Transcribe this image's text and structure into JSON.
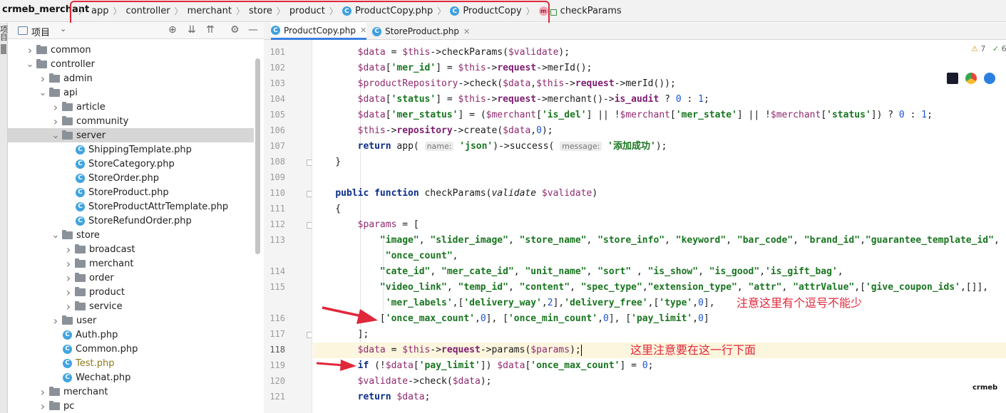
{
  "navbar": {
    "project": "crmeb_merchant",
    "crumbs": [
      {
        "label": "app",
        "icon": ""
      },
      {
        "label": "controller",
        "icon": ""
      },
      {
        "label": "merchant",
        "icon": ""
      },
      {
        "label": "store",
        "icon": ""
      },
      {
        "label": "product",
        "icon": ""
      },
      {
        "label": "ProductCopy.php",
        "icon": "php-class-icon"
      },
      {
        "label": "ProductCopy",
        "icon": "php-class-icon"
      },
      {
        "label": "checkParams",
        "icon": "method-icon"
      }
    ],
    "highlight_color": "#e0283a"
  },
  "toolstrip": {
    "label": "项目"
  },
  "project_panel": {
    "title": "项目",
    "tree": [
      {
        "label": "common",
        "type": "folder",
        "depth": 2,
        "expanded": false
      },
      {
        "label": "controller",
        "type": "folder",
        "depth": 2,
        "expanded": true
      },
      {
        "label": "admin",
        "type": "folder",
        "depth": 3,
        "expanded": false
      },
      {
        "label": "api",
        "type": "folder",
        "depth": 3,
        "expanded": true
      },
      {
        "label": "article",
        "type": "folder",
        "depth": 4,
        "expanded": false
      },
      {
        "label": "community",
        "type": "folder",
        "depth": 4,
        "expanded": false
      },
      {
        "label": "server",
        "type": "folder",
        "depth": 4,
        "expanded": true,
        "selected": true
      },
      {
        "label": "ShippingTemplate.php",
        "type": "file",
        "depth": 5
      },
      {
        "label": "StoreCategory.php",
        "type": "file",
        "depth": 5
      },
      {
        "label": "StoreOrder.php",
        "type": "file",
        "depth": 5
      },
      {
        "label": "StoreProduct.php",
        "type": "file",
        "depth": 5
      },
      {
        "label": "StoreProductAttrTemplate.php",
        "type": "file",
        "depth": 5
      },
      {
        "label": "StoreRefundOrder.php",
        "type": "file",
        "depth": 5
      },
      {
        "label": "store",
        "type": "folder",
        "depth": 4,
        "expanded": true
      },
      {
        "label": "broadcast",
        "type": "folder",
        "depth": 5,
        "expanded": false
      },
      {
        "label": "merchant",
        "type": "folder",
        "depth": 5,
        "expanded": false
      },
      {
        "label": "order",
        "type": "folder",
        "depth": 5,
        "expanded": false
      },
      {
        "label": "product",
        "type": "folder",
        "depth": 5,
        "expanded": false
      },
      {
        "label": "service",
        "type": "folder",
        "depth": 5,
        "expanded": false
      },
      {
        "label": "user",
        "type": "folder",
        "depth": 4,
        "expanded": false
      },
      {
        "label": "Auth.php",
        "type": "file",
        "depth": 4
      },
      {
        "label": "Common.php",
        "type": "file",
        "depth": 4
      },
      {
        "label": "Test.php",
        "type": "file",
        "depth": 4,
        "warning": true
      },
      {
        "label": "Wechat.php",
        "type": "file",
        "depth": 4
      },
      {
        "label": "merchant",
        "type": "folder",
        "depth": 3,
        "expanded": false
      },
      {
        "label": "pc",
        "type": "folder",
        "depth": 3,
        "expanded": false
      }
    ]
  },
  "editor": {
    "tabs": [
      {
        "label": "ProductCopy.php",
        "active": true
      },
      {
        "label": "StoreProduct.php",
        "active": false
      }
    ],
    "inspection": {
      "warnings": "7",
      "ok": "6"
    },
    "watermark": "crmeb",
    "lines": [
      {
        "no": "101",
        "code": [
          [
            "",
            "        "
          ],
          [
            "v",
            "$data"
          ],
          [
            "",
            " = "
          ],
          [
            "v",
            "$this"
          ],
          [
            "",
            "->checkParams("
          ],
          [
            "v",
            "$validate"
          ],
          [
            "",
            ");"
          ]
        ]
      },
      {
        "no": "102",
        "code": [
          [
            "",
            "        "
          ],
          [
            "v",
            "$data"
          ],
          [
            "",
            "["
          ],
          [
            "s",
            "'mer_id'"
          ],
          [
            "",
            "] = "
          ],
          [
            "v",
            "$this"
          ],
          [
            "",
            "->"
          ],
          [
            "pp",
            "request"
          ],
          [
            "",
            "->merId();"
          ]
        ]
      },
      {
        "no": "103",
        "code": [
          [
            "",
            "        "
          ],
          [
            "v",
            "$productRepository"
          ],
          [
            "",
            "->check("
          ],
          [
            "v",
            "$data"
          ],
          [
            "",
            ","
          ],
          [
            "v",
            "$this"
          ],
          [
            "",
            "->"
          ],
          [
            "pp",
            "request"
          ],
          [
            "",
            "->merId());"
          ]
        ]
      },
      {
        "no": "104",
        "code": [
          [
            "",
            "        "
          ],
          [
            "v",
            "$data"
          ],
          [
            "",
            "["
          ],
          [
            "s",
            "'status'"
          ],
          [
            "",
            "] = "
          ],
          [
            "v",
            "$this"
          ],
          [
            "",
            "->"
          ],
          [
            "pp",
            "request"
          ],
          [
            "",
            "->merchant()->"
          ],
          [
            "pp",
            "is_audit"
          ],
          [
            "",
            " ? "
          ],
          [
            "n",
            "0"
          ],
          [
            "",
            " : "
          ],
          [
            "n",
            "1"
          ],
          [
            "",
            ";"
          ]
        ]
      },
      {
        "no": "105",
        "code": [
          [
            "",
            "        "
          ],
          [
            "v",
            "$data"
          ],
          [
            "",
            "["
          ],
          [
            "s",
            "'mer_status'"
          ],
          [
            "",
            "] = ("
          ],
          [
            "v",
            "$merchant"
          ],
          [
            "",
            "["
          ],
          [
            "s",
            "'is_del'"
          ],
          [
            "",
            "] || !"
          ],
          [
            "v",
            "$merchant"
          ],
          [
            "",
            "["
          ],
          [
            "s",
            "'mer_state'"
          ],
          [
            "",
            "] || !"
          ],
          [
            "v",
            "$merchant"
          ],
          [
            "",
            "["
          ],
          [
            "s",
            "'status'"
          ],
          [
            "",
            "]) ? "
          ],
          [
            "n",
            "0"
          ],
          [
            "",
            " : "
          ],
          [
            "n",
            "1"
          ],
          [
            "",
            ";"
          ]
        ]
      },
      {
        "no": "106",
        "code": [
          [
            "",
            "        "
          ],
          [
            "v",
            "$this"
          ],
          [
            "",
            "->"
          ],
          [
            "pp",
            "repository"
          ],
          [
            "",
            "->create("
          ],
          [
            "v",
            "$data"
          ],
          [
            "",
            ","
          ],
          [
            "n",
            "0"
          ],
          [
            "",
            ");"
          ]
        ]
      },
      {
        "no": "107",
        "code": [
          [
            "",
            "        "
          ],
          [
            "k",
            "return"
          ],
          [
            "",
            " app( "
          ],
          [
            "hint",
            "name:"
          ],
          [
            "",
            " "
          ],
          [
            "s",
            "'json'"
          ],
          [
            "",
            ")->success( "
          ],
          [
            "hint",
            "message:"
          ],
          [
            "",
            " "
          ],
          [
            "s",
            "'添加成功'"
          ],
          [
            "",
            ");"
          ]
        ]
      },
      {
        "no": "108",
        "code": [
          [
            "",
            "    }"
          ]
        ]
      },
      {
        "no": "109",
        "code": [
          [
            "",
            ""
          ]
        ]
      },
      {
        "no": "110",
        "code": [
          [
            "",
            "    "
          ],
          [
            "k",
            "public function"
          ],
          [
            "",
            " checkParams("
          ],
          [
            "it",
            "validate"
          ],
          [
            "",
            " "
          ],
          [
            "v",
            "$validate"
          ],
          [
            "",
            ")"
          ]
        ]
      },
      {
        "no": "111",
        "code": [
          [
            "",
            "    {"
          ]
        ]
      },
      {
        "no": "112",
        "code": [
          [
            "",
            "        "
          ],
          [
            "v",
            "$params"
          ],
          [
            "",
            " = ["
          ]
        ]
      },
      {
        "no": "113",
        "code": [
          [
            "",
            "            "
          ],
          [
            "s",
            "\"image\""
          ],
          [
            "",
            ", "
          ],
          [
            "s",
            "\"slider_image\""
          ],
          [
            "",
            ", "
          ],
          [
            "s",
            "\"store_name\""
          ],
          [
            "",
            ", "
          ],
          [
            "s",
            "\"store_info\""
          ],
          [
            "",
            ", "
          ],
          [
            "s",
            "\"keyword\""
          ],
          [
            "",
            ", "
          ],
          [
            "s",
            "\"bar_code\""
          ],
          [
            "",
            ", "
          ],
          [
            "s",
            "\"brand_id\""
          ],
          [
            "",
            ","
          ],
          [
            "s",
            "\"guarantee_template_id\""
          ],
          [
            "",
            ","
          ]
        ]
      },
      {
        "no": "",
        "code": [
          [
            "",
            "             "
          ],
          [
            "s",
            "\"once_count\""
          ],
          [
            "",
            ","
          ]
        ]
      },
      {
        "no": "114",
        "code": [
          [
            "",
            "            "
          ],
          [
            "s",
            "\"cate_id\""
          ],
          [
            "",
            ", "
          ],
          [
            "s",
            "\"mer_cate_id\""
          ],
          [
            "",
            ", "
          ],
          [
            "s",
            "\"unit_name\""
          ],
          [
            "",
            ", "
          ],
          [
            "s",
            "\"sort\""
          ],
          [
            "",
            " , "
          ],
          [
            "s",
            "\"is_show\""
          ],
          [
            "",
            ", "
          ],
          [
            "s",
            "\"is_good\""
          ],
          [
            "",
            ","
          ],
          [
            "s",
            "'is_gift_bag'"
          ],
          [
            "",
            ","
          ]
        ]
      },
      {
        "no": "115",
        "code": [
          [
            "",
            "            "
          ],
          [
            "s",
            "\"video_link\""
          ],
          [
            "",
            ", "
          ],
          [
            "s",
            "\"temp_id\""
          ],
          [
            "",
            ", "
          ],
          [
            "s",
            "\"content\""
          ],
          [
            "",
            ", "
          ],
          [
            "s",
            "\"spec_type\""
          ],
          [
            "",
            ","
          ],
          [
            "s",
            "\"extension_type\""
          ],
          [
            "",
            ", "
          ],
          [
            "s",
            "\"attr\""
          ],
          [
            "",
            ", "
          ],
          [
            "s",
            "\"attrValue\""
          ],
          [
            "",
            ",["
          ],
          [
            "s",
            "'give_coupon_ids'"
          ],
          [
            "",
            ",[]],"
          ]
        ]
      },
      {
        "no": "",
        "code": [
          [
            "",
            "             "
          ],
          [
            "s",
            "'mer_labels'"
          ],
          [
            "",
            ",["
          ],
          [
            "s",
            "'delivery_way'"
          ],
          [
            "",
            ","
          ],
          [
            "n",
            "2"
          ],
          [
            "",
            "],"
          ],
          [
            "s",
            "'delivery_free'"
          ],
          [
            "",
            ",["
          ],
          [
            "s",
            "'type'"
          ],
          [
            "",
            ","
          ],
          [
            "n",
            "0"
          ],
          [
            "",
            "],"
          ]
        ]
      },
      {
        "no": "116",
        "code": [
          [
            "",
            "            ["
          ],
          [
            "s",
            "'once_max_count'"
          ],
          [
            "",
            ","
          ],
          [
            "n",
            "0"
          ],
          [
            "",
            "], ["
          ],
          [
            "s",
            "'once_min_count'"
          ],
          [
            "",
            ","
          ],
          [
            "n",
            "0"
          ],
          [
            "",
            "], ["
          ],
          [
            "s",
            "'pay_limit'"
          ],
          [
            "",
            ","
          ],
          [
            "n",
            "0"
          ],
          [
            "",
            "]"
          ]
        ]
      },
      {
        "no": "117",
        "code": [
          [
            "",
            "        ];"
          ]
        ]
      },
      {
        "no": "118",
        "code": [
          [
            "",
            "        "
          ],
          [
            "v",
            "$data"
          ],
          [
            "",
            " = "
          ],
          [
            "v",
            "$this"
          ],
          [
            "",
            "->"
          ],
          [
            "pp",
            "request"
          ],
          [
            "",
            "->params("
          ],
          [
            "v",
            "$params"
          ],
          [
            "",
            ");"
          ]
        ],
        "current": true
      },
      {
        "no": "119",
        "code": [
          [
            "",
            "        "
          ],
          [
            "k",
            "if"
          ],
          [
            "",
            " (!"
          ],
          [
            "v",
            "$data"
          ],
          [
            "",
            "["
          ],
          [
            "s",
            "'pay_limit'"
          ],
          [
            "",
            "]) "
          ],
          [
            "v",
            "$data"
          ],
          [
            "",
            "["
          ],
          [
            "s",
            "'once_max_count'"
          ],
          [
            "",
            "] = "
          ],
          [
            "n",
            "0"
          ],
          [
            "",
            ";"
          ]
        ]
      },
      {
        "no": "120",
        "code": [
          [
            "",
            "        "
          ],
          [
            "v",
            "$validate"
          ],
          [
            "",
            "->check("
          ],
          [
            "v",
            "$data"
          ],
          [
            "",
            ");"
          ]
        ]
      },
      {
        "no": "121",
        "code": [
          [
            "",
            "        "
          ],
          [
            "k",
            "return"
          ],
          [
            "",
            " "
          ],
          [
            "v",
            "$data"
          ],
          [
            "",
            ";"
          ]
        ]
      }
    ]
  },
  "annotations": {
    "note_comma": "注意这里有个逗号不能少",
    "note_below": "这里注意要在这一行下面",
    "color": "#e0283a"
  }
}
